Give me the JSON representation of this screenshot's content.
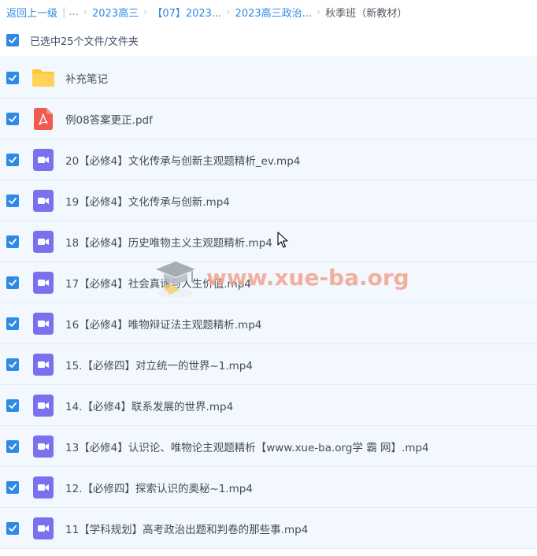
{
  "breadcrumb": {
    "back": "返回上一级",
    "sep": "|",
    "dots": "...",
    "items": [
      "2023高三",
      "【07】2023...",
      "2023高三政治..."
    ],
    "current": "秋季班（新教材）"
  },
  "selection": {
    "label": "已选中25个文件/文件夹",
    "checked": true
  },
  "files": [
    {
      "name": "补充笔记",
      "type": "folder"
    },
    {
      "name": "例08答案更正.pdf",
      "type": "pdf"
    },
    {
      "name": "20【必修4】文化传承与创新主观题精析_ev.mp4",
      "type": "video"
    },
    {
      "name": "19【必修4】文化传承与创新.mp4",
      "type": "video"
    },
    {
      "name": "18【必修4】历史唯物主义主观题精析.mp4",
      "type": "video"
    },
    {
      "name": "17【必修4】社会真谛与人生价值.mp4",
      "type": "video"
    },
    {
      "name": "16【必修4】唯物辩证法主观题精析.mp4",
      "type": "video"
    },
    {
      "name": "15.【必修四】对立统一的世界~1.mp4",
      "type": "video"
    },
    {
      "name": "14.【必修4】联系发展的世界.mp4",
      "type": "video"
    },
    {
      "name": "13【必修4】认识论、唯物论主观题精析【www.xue-ba.org学 霸 网】.mp4",
      "type": "video"
    },
    {
      "name": "12.【必修四】探索认识的奥秘~1.mp4",
      "type": "video"
    },
    {
      "name": "11【学科规划】高考政治出题和判卷的那些事.mp4",
      "type": "video"
    }
  ],
  "icons": {
    "folder": "folder-icon",
    "pdf": "pdf-icon",
    "video": "video-icon",
    "checkbox": "checkbox-checked-icon"
  },
  "colors": {
    "accent": "#2f8ae5",
    "row_bg": "#f2f8fe",
    "folder": "#ffcd48",
    "pdf": "#f05a4f",
    "video": "#7b70ee"
  },
  "watermark": {
    "text": "www.xue-ba.org"
  }
}
